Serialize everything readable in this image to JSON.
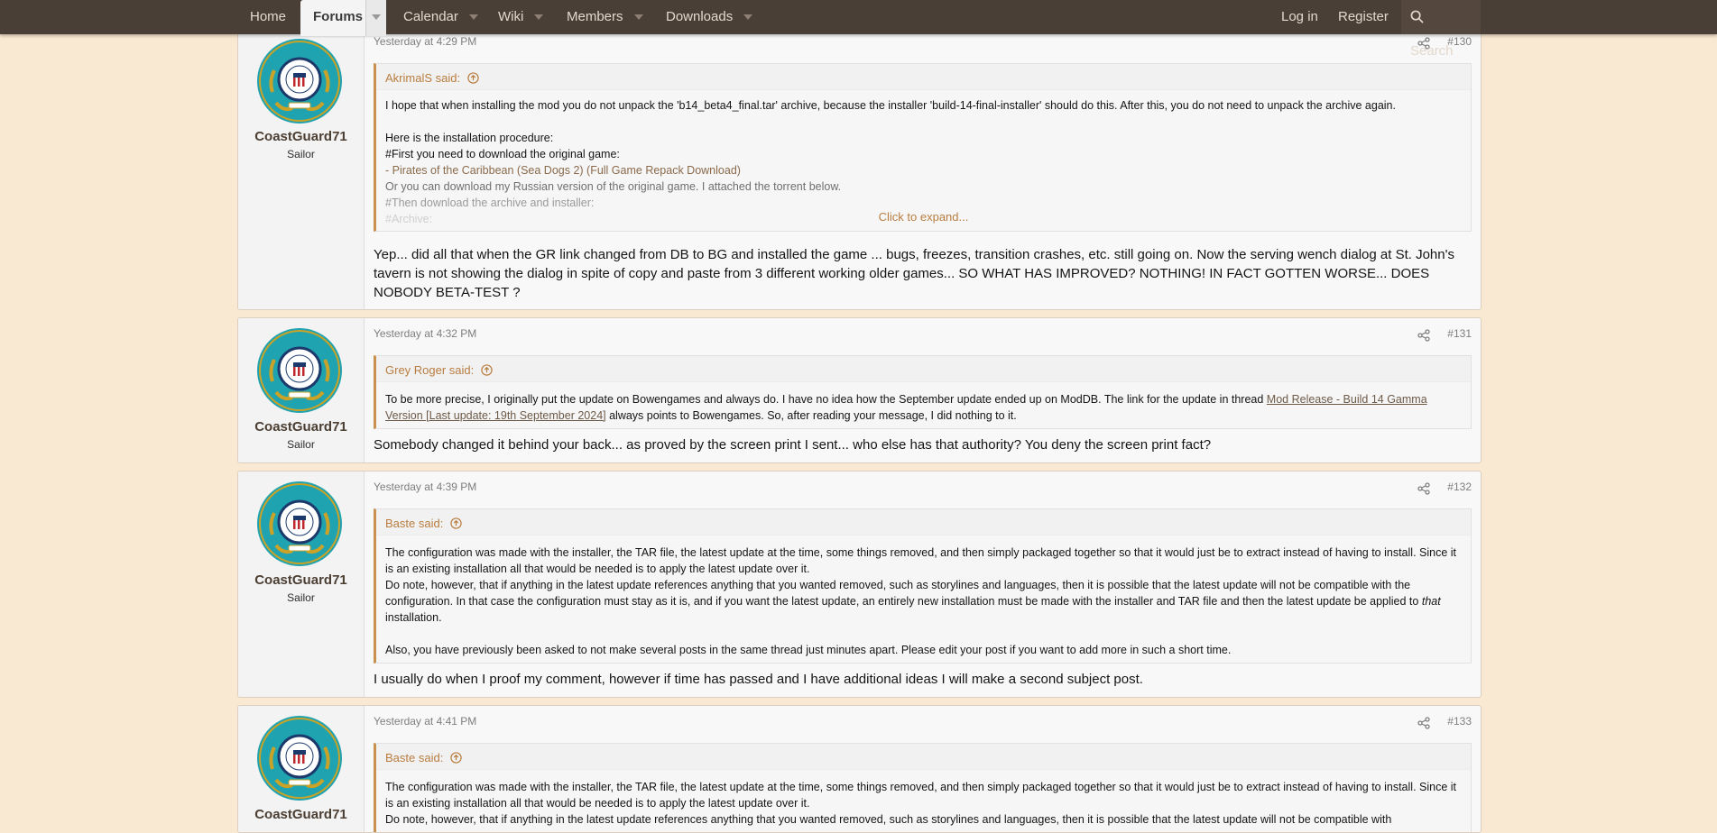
{
  "nav": {
    "home": "Home",
    "forums": "Forums",
    "calendar": "Calendar",
    "wiki": "Wiki",
    "members": "Members",
    "downloads": "Downloads",
    "login": "Log in",
    "register": "Register",
    "search": "Search"
  },
  "posts": [
    {
      "username": "CoastGuard71",
      "usertitle": "Sailor",
      "date": "Yesterday at 4:29 PM",
      "number": "#130",
      "quote_author": "AkrimalS said:",
      "quote_lines": [
        "I hope that when installing the mod you do not unpack the 'b14_beta4_final.tar' archive, because the installer 'build-14-final-installer' should do this. After this, you do not need to unpack the archive again.",
        "Here is the installation procedure:",
        "#First you need to download the original game:",
        "- Pirates of the Caribbean (Sea Dogs 2) (Full Game Repack Download)",
        "Or you can download my Russian version of the original game. I attached the torrent below.",
        "#Then download the archive and installer:",
        "#Archive:"
      ],
      "expand": "Click to expand...",
      "message": "Yep... did all that when the GR link changed from DB to BG and installed the game ... bugs, freezes, transition crashes, etc. still going on. Now the serving wench dialog at St. John's tavern is not showing the dialog in spite of copy and paste from 3 different working older games... SO WHAT HAS IMPROVED? NOTHING! IN FACT GOTTEN WORSE... DOES NOBODY BETA-TEST ?"
    },
    {
      "username": "CoastGuard71",
      "usertitle": "Sailor",
      "date": "Yesterday at 4:32 PM",
      "number": "#131",
      "quote_author": "Grey Roger said:",
      "quote_text_1": "To be more precise, I originally put the update on Bowengames and always do. I have no idea how the September update ended up on ModDB. The link for the update in thread ",
      "quote_link": "Mod Release - Build 14 Gamma Version [Last update: 19th September 2024]",
      "quote_text_2": " always points to Bowengames. So, after reading your message, I did nothing to it.",
      "message": "Somebody changed it behind your back... as proved by the screen print I sent... who else has that authority? You deny the screen print fact?"
    },
    {
      "username": "CoastGuard71",
      "usertitle": "Sailor",
      "date": "Yesterday at 4:39 PM",
      "number": "#132",
      "quote_author": "Baste said:",
      "quote_p1": "The configuration was made with the installer, the TAR file, the latest update at the time, some things removed, and then simply packaged together so that it would just be to extract instead of having to install. Since it is an existing installation all that would be needed is to apply the latest update over it.",
      "quote_p2a": "Do note, however, that if anything in the latest update references anything that you wanted removed, such as storylines and languages, then it is possible that the latest update will not be compatible with the configuration. In that case the configuration must stay as it is, and if you want the latest update, an entirely new installation must be made with the installer and TAR file and then the latest update be applied to ",
      "quote_p2_em": "that",
      "quote_p2b": " installation.",
      "quote_p3": "Also, you have previously been asked to not make several posts in the same thread just minutes apart. Please edit your post if you want to add more in such a short time.",
      "message": "I usually do when I proof my comment, however if time has passed and I have additional ideas I will make a second subject post."
    },
    {
      "username": "CoastGuard71",
      "usertitle": "Sailor",
      "date": "Yesterday at 4:41 PM",
      "number": "#133",
      "quote_author": "Baste said:",
      "quote_p1": "The configuration was made with the installer, the TAR file, the latest update at the time, some things removed, and then simply packaged together so that it would just be to extract instead of having to install. Since it is an existing installation all that would be needed is to apply the latest update over it.",
      "quote_p2": "Do note, however, that if anything in the latest update references anything that you wanted removed, such as storylines and languages, then it is possible that the latest update will not be compatible with"
    }
  ]
}
